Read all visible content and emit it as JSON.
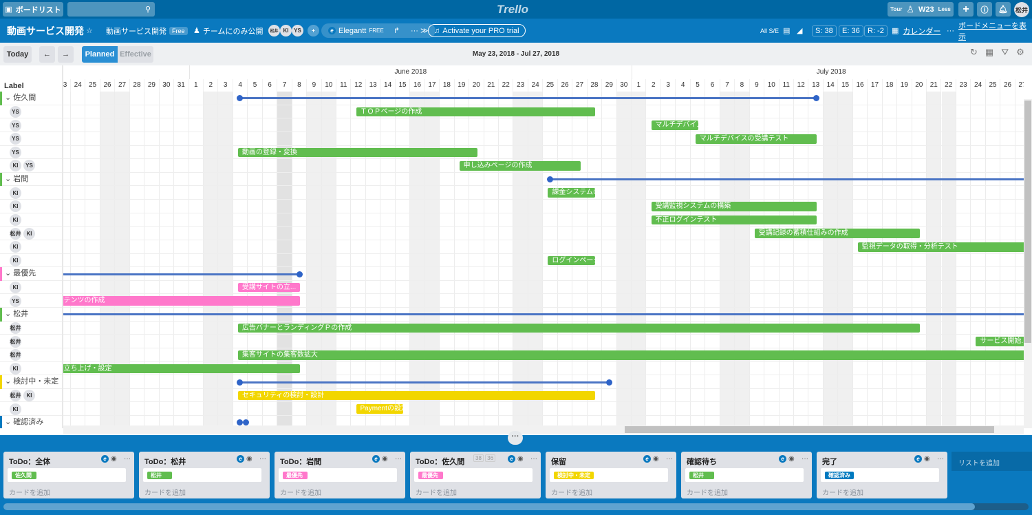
{
  "topbar": {
    "boards_label": "ボードリスト",
    "logo": "Trello",
    "tour": "Tour",
    "week": "W23",
    "less": "Less",
    "user": "松井"
  },
  "header": {
    "board_title": "動画サービス開発",
    "team": "動画サービス開発",
    "team_badge": "Free",
    "visibility": "チームにのみ公開",
    "members": [
      "松井",
      "KI",
      "YS"
    ],
    "powerup": "Elegantt",
    "powerup_badge": "FREE",
    "pro_trial": "Activate your PRO trial",
    "all_se": "All S/E",
    "s_count": "S: 38",
    "e_count": "E: 36",
    "r_count": "R: -2",
    "calendar": "カレンダー",
    "menu": "ボードメニューを表示"
  },
  "gantt": {
    "today": "Today",
    "prev": "←",
    "next": "→",
    "planned": "Planned",
    "effective": "Effective",
    "range": "May 23, 2018 - Jul 27, 2018",
    "label_header": "Label",
    "months": [
      {
        "label": "June 2018",
        "month": 6
      },
      {
        "label": "July 2018",
        "month": 7
      }
    ],
    "start_date": "2018-05-23",
    "end_date": "2018-07-27",
    "today_date": "2018-06-07",
    "rows": [
      {
        "type": "group",
        "label": "佐久間",
        "color": "#61bd4f",
        "line": [
          "2018-06-04",
          "2018-07-13"
        ],
        "dots": [
          "start",
          "end"
        ]
      },
      {
        "avatars": [
          "YS"
        ],
        "bar": {
          "text": "ＴＯＰページの作成",
          "start": "2018-06-12",
          "end": "2018-06-28",
          "color": "#61bd4f"
        }
      },
      {
        "avatars": [
          "YS"
        ],
        "bar": {
          "text": "マルチデバイス...",
          "start": "2018-07-02",
          "end": "2018-07-05",
          "color": "#61bd4f"
        }
      },
      {
        "avatars": [
          "YS"
        ],
        "bar": {
          "text": "マルチデバイスの受講テスト",
          "start": "2018-07-05",
          "end": "2018-07-13",
          "color": "#61bd4f"
        }
      },
      {
        "avatars": [
          "YS"
        ],
        "bar": {
          "text": "動画の登録・変換",
          "start": "2018-06-04",
          "end": "2018-06-20",
          "color": "#61bd4f"
        }
      },
      {
        "avatars": [
          "KI",
          "YS"
        ],
        "bar": {
          "text": "申し込みページの作成",
          "start": "2018-06-19",
          "end": "2018-06-27",
          "color": "#61bd4f"
        }
      },
      {
        "type": "group",
        "label": "岩間",
        "color": "#61bd4f",
        "line": [
          "2018-06-25",
          "2018-07-27"
        ],
        "dots": [
          "start"
        ]
      },
      {
        "avatars": [
          "KI"
        ],
        "bar": {
          "text": "課金システムの...",
          "start": "2018-06-25",
          "end": "2018-06-28",
          "color": "#61bd4f"
        }
      },
      {
        "avatars": [
          "KI"
        ],
        "bar": {
          "text": "受講監視システムの構築",
          "start": "2018-07-02",
          "end": "2018-07-13",
          "color": "#61bd4f"
        }
      },
      {
        "avatars": [
          "KI"
        ],
        "bar": {
          "text": "不正ログインテスト",
          "start": "2018-07-02",
          "end": "2018-07-13",
          "color": "#61bd4f"
        }
      },
      {
        "avatars": [
          "松井",
          "KI"
        ],
        "bar": {
          "text": "受講記録の蓄積仕組みの作成",
          "start": "2018-07-09",
          "end": "2018-07-20",
          "color": "#61bd4f"
        }
      },
      {
        "avatars": [
          "KI"
        ],
        "bar": {
          "text": "監視データの取得・分析テスト",
          "start": "2018-07-16",
          "end": "2018-07-27",
          "color": "#61bd4f"
        }
      },
      {
        "avatars": [
          "KI"
        ],
        "bar": {
          "text": "ログインページ...",
          "start": "2018-06-25",
          "end": "2018-06-28",
          "color": "#61bd4f"
        }
      },
      {
        "type": "group",
        "label": "最優先",
        "color": "#ff78cb",
        "line": [
          "2018-05-23",
          "2018-06-08"
        ],
        "dots": [
          "end"
        ]
      },
      {
        "avatars": [
          "KI"
        ],
        "bar": {
          "text": "受講サイトの立...",
          "start": "2018-06-04",
          "end": "2018-06-08",
          "color": "#ff78cb"
        }
      },
      {
        "avatars": [
          "YS"
        ],
        "bar": {
          "text": "テンツの作成",
          "start": "2018-05-23",
          "end": "2018-06-08",
          "color": "#ff78cb",
          "clipped": true
        }
      },
      {
        "type": "group",
        "label": "松井",
        "color": "#61bd4f",
        "line": [
          "2018-05-23",
          "2018-07-27"
        ],
        "dots": []
      },
      {
        "avatars": [
          "松井"
        ],
        "bar": {
          "text": "広告バナーとランディングＰの作成",
          "start": "2018-06-04",
          "end": "2018-07-20",
          "color": "#61bd4f"
        }
      },
      {
        "avatars": [
          "松井"
        ],
        "bar": {
          "text": "サービス開始...",
          "start": "2018-07-24",
          "end": "2018-07-27",
          "color": "#61bd4f"
        }
      },
      {
        "avatars": [
          "松井"
        ],
        "bar": {
          "text": "集客サイトの集客数拡大",
          "start": "2018-06-04",
          "end": "2018-07-27",
          "color": "#61bd4f"
        }
      },
      {
        "avatars": [
          "KI"
        ],
        "bar": {
          "text": "立ち上げ・設定",
          "start": "2018-05-23",
          "end": "2018-06-08",
          "color": "#61bd4f",
          "clipped": true
        }
      },
      {
        "type": "group",
        "label": "検討中・未定",
        "color": "#f2d600",
        "line": [
          "2018-06-04",
          "2018-06-29"
        ],
        "dots": [
          "start",
          "end"
        ]
      },
      {
        "avatars": [
          "松井",
          "KI"
        ],
        "bar": {
          "text": "セキュリティの検討・設計",
          "start": "2018-06-04",
          "end": "2018-06-28",
          "color": "#f2d600"
        }
      },
      {
        "avatars": [
          "KI"
        ],
        "bar": {
          "text": "Paymentの設定",
          "start": "2018-06-12",
          "end": "2018-06-15",
          "color": "#f2d600"
        }
      },
      {
        "type": "group",
        "label": "確認済み",
        "color": "#0079bf",
        "line": [
          "2018-06-04",
          "2018-06-04"
        ],
        "dots": [
          "start",
          "end"
        ]
      }
    ]
  },
  "lists": [
    {
      "title": "ToDo：全体",
      "label": "佐久間",
      "label_color": "#61bd4f",
      "add": "カードを追加"
    },
    {
      "title": "ToDo：松井",
      "label": "松井",
      "label_color": "#61bd4f",
      "add": "カードを追加"
    },
    {
      "title": "ToDo：岩間",
      "label": "最優先",
      "label_color": "#ff78cb",
      "add": "カードを追加"
    },
    {
      "title": "ToDo：佐久間",
      "label": "最優先",
      "label_color": "#ff78cb",
      "add": "カードを追加",
      "counts": [
        "38",
        "36"
      ]
    },
    {
      "title": "保留",
      "label": "検討中・未定",
      "label_color": "#f2d600",
      "add": "カードを追加"
    },
    {
      "title": "確認待ち",
      "label": "松井",
      "label_color": "#61bd4f",
      "add": "カードを追加"
    },
    {
      "title": "完了",
      "label": "確認済み",
      "label_color": "#0079bf",
      "add": "カードを追加"
    }
  ],
  "add_list": "リストを追加"
}
